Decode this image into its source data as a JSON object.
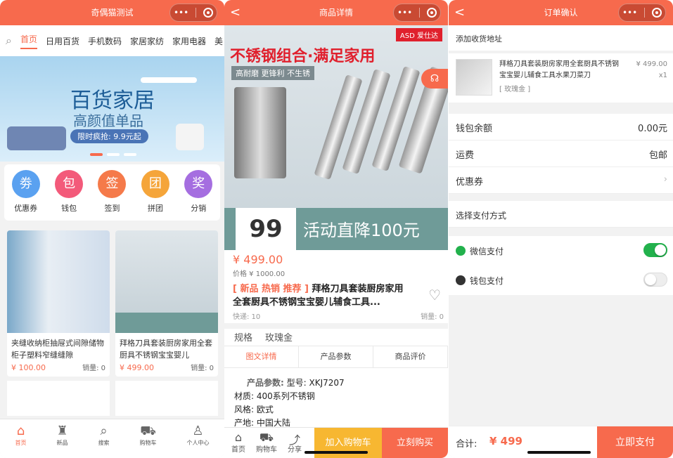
{
  "colors": {
    "accent": "#f76a4d",
    "switch_on": "#22b14c",
    "cart_button": "#f7b731"
  },
  "home": {
    "title": "奇偶猫测试",
    "categories": [
      "首页",
      "日用百货",
      "手机数码",
      "家居家纺",
      "家用电器",
      "美"
    ],
    "banner": {
      "title": "百货家居",
      "subtitle": "高颜值单品",
      "promo": "限时疯抢: 9.9元起"
    },
    "icons": [
      {
        "label": "优惠券",
        "glyph": "劵",
        "color": "#5aa1f0"
      },
      {
        "label": "钱包",
        "glyph": "包",
        "color": "#f35a7a"
      },
      {
        "label": "签到",
        "glyph": "签",
        "color": "#f57a4a"
      },
      {
        "label": "拼团",
        "glyph": "团",
        "color": "#f5a53a"
      },
      {
        "label": "分销",
        "glyph": "奖",
        "color": "#a56ee0"
      }
    ],
    "products": [
      {
        "name": "夹缝收纳柜抽屉式间隙储物柜子塑料窄缝缝隙",
        "price": "¥ 100.00",
        "sales": "销量: 0"
      },
      {
        "name": "拜格刀具套装厨房家用全套厨具不锈钢宝宝婴儿",
        "price": "¥ 499.00",
        "sales": "销量: 0"
      }
    ],
    "tabs": [
      {
        "label": "首页",
        "icon": "home-icon",
        "glyph": "⌂"
      },
      {
        "label": "新品",
        "icon": "bag-icon",
        "glyph": "♜"
      },
      {
        "label": "搜索",
        "icon": "search-icon",
        "glyph": "⌕"
      },
      {
        "label": "购物车",
        "icon": "cart-icon",
        "glyph": "⛟"
      },
      {
        "label": "个人中心",
        "icon": "user-icon",
        "glyph": "♙"
      }
    ]
  },
  "detail": {
    "title": "商品详情",
    "image": {
      "brand": "ASD 爱仕达",
      "headline": "不锈钢组合·满足家用",
      "sub": "高耐磨 更锋利 不生锈",
      "big_price": "99",
      "promo": "活动直降100元"
    },
    "price": "¥ 499.00",
    "orig_price": "价格 ¥ 1000.00",
    "tags": "[ 新品 热销 推荐 ]",
    "name": "拜格刀具套装厨房家用全套厨具不锈钢宝宝婴儿辅食工具...",
    "shipping": "快递: 10",
    "sales": "销量: 0",
    "spec_label": "规格",
    "spec_value": "玫瑰金",
    "tabs": [
      "图文详情",
      "产品参数",
      "商品评价"
    ],
    "params_header": "产品参数:",
    "params": [
      "型号: XKJ7207",
      "材质: 400系列不锈钢",
      "风格: 欧式",
      "产地: 中国大陆"
    ],
    "bottom": [
      {
        "label": "首页",
        "icon": "home-icon",
        "glyph": "⌂"
      },
      {
        "label": "购物车",
        "icon": "cart-icon",
        "glyph": "⛟"
      },
      {
        "label": "分享",
        "icon": "share-icon",
        "glyph": "⤴"
      }
    ],
    "add_cart": "加入购物车",
    "buy_now": "立刻购买"
  },
  "order": {
    "title": "订单确认",
    "add_address": "添加收货地址",
    "item_name": "拜格刀具套装厨房家用全套厨具不锈钢宝宝婴儿辅食工具水果刀菜刀",
    "item_spec": "[ 玫瑰金 ]",
    "item_price": "¥ 499.00",
    "item_qty": "x1",
    "wallet_label": "钱包余额",
    "wallet_value": "0.00元",
    "shipping_label": "运费",
    "shipping_value": "包邮",
    "coupon_label": "优惠券",
    "pay_method_title": "选择支付方式",
    "pay_options": [
      {
        "label": "微信支付",
        "enabled": true
      },
      {
        "label": "钱包支付",
        "enabled": false
      }
    ],
    "total_label": "合计:",
    "total_value": "¥ 499",
    "pay_button": "立即支付"
  }
}
